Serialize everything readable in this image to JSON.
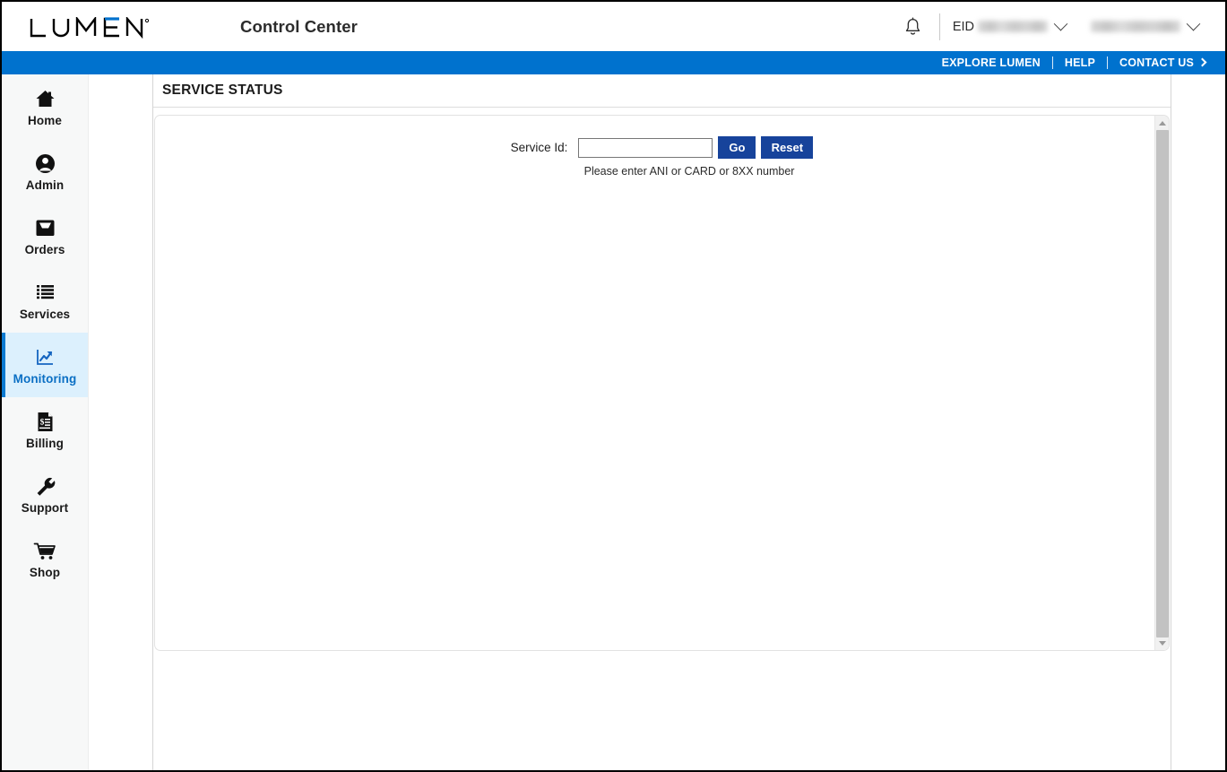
{
  "header": {
    "logo_text": "LUMEN",
    "logo_trademark": "®",
    "app_title": "Control Center",
    "bell_icon": "notification-bell-icon",
    "eid_label": "EID",
    "eid_value": "",
    "user_value": "",
    "eid_chevron": "chevron-down-icon",
    "user_chevron": "chevron-down-icon"
  },
  "blue_nav": {
    "links": [
      {
        "label": "EXPLORE LUMEN",
        "name": "explore-lumen-link"
      },
      {
        "label": "HELP",
        "name": "help-link"
      },
      {
        "label": "CONTACT US",
        "name": "contact-us-link"
      }
    ],
    "contact_chevron": "chevron-right-icon",
    "background_color": "#0072ce"
  },
  "sidebar": {
    "active_index": 4,
    "active_bg_color": "#dcf0fd",
    "active_accent_color": "#0b7ad1",
    "items": [
      {
        "label": "Home",
        "icon": "home-icon"
      },
      {
        "label": "Admin",
        "icon": "user-circle-icon"
      },
      {
        "label": "Orders",
        "icon": "inbox-tray-icon"
      },
      {
        "label": "Services",
        "icon": "list-icon"
      },
      {
        "label": "Monitoring",
        "icon": "chart-trending-up-icon"
      },
      {
        "label": "Billing",
        "icon": "invoice-dollar-icon"
      },
      {
        "label": "Support",
        "icon": "wrench-icon"
      },
      {
        "label": "Shop",
        "icon": "shopping-cart-icon"
      }
    ]
  },
  "main": {
    "page_title": "SERVICE STATUS",
    "form": {
      "service_id_label": "Service Id:",
      "service_id_value": "",
      "service_id_placeholder": "",
      "go_button": "Go",
      "reset_button": "Reset",
      "helper_text": "Please enter ANI or CARD or 8XX number",
      "button_color": "#17439b"
    },
    "scrollbar": {
      "up_arrow": "scroll-up-arrow-icon",
      "down_arrow": "scroll-down-arrow-icon",
      "thumb": "scrollbar-thumb"
    }
  }
}
